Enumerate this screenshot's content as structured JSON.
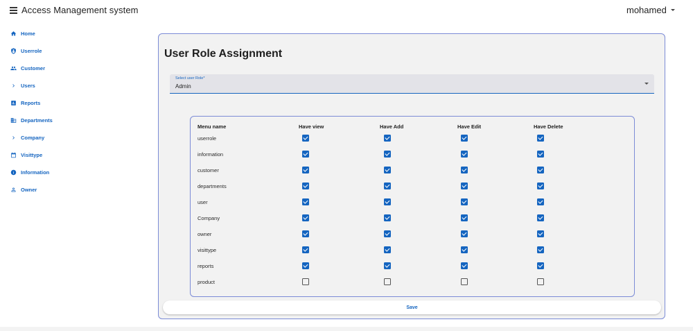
{
  "app": {
    "title": "Access Management system",
    "user_name": "mohamed"
  },
  "sidebar": {
    "items": [
      {
        "label": "Home",
        "icon": "home-icon"
      },
      {
        "label": "Userrole",
        "icon": "shield-user-icon"
      },
      {
        "label": "Customer",
        "icon": "people-icon"
      },
      {
        "label": "Users",
        "icon": "chevron-right-icon"
      },
      {
        "label": "Reports",
        "icon": "bar-chart-icon"
      },
      {
        "label": "Departments",
        "icon": "building-icon"
      },
      {
        "label": "Company",
        "icon": "chevron-right-icon"
      },
      {
        "label": "Visittype",
        "icon": "calendar-icon"
      },
      {
        "label": "Information",
        "icon": "info-icon"
      },
      {
        "label": "Owner",
        "icon": "person-outline-icon"
      }
    ]
  },
  "main": {
    "title": "User Role Assignment",
    "select": {
      "label": "Select user Role*",
      "value": "Admin"
    },
    "table": {
      "headers": [
        "Menu name",
        "Have view",
        "Have Add",
        "Have Edit",
        "Have Delete"
      ],
      "rows": [
        {
          "name": "userrole",
          "view": true,
          "add": true,
          "edit": true,
          "delete": true
        },
        {
          "name": "information",
          "view": true,
          "add": true,
          "edit": true,
          "delete": true
        },
        {
          "name": "customer",
          "view": true,
          "add": true,
          "edit": true,
          "delete": true
        },
        {
          "name": "departments",
          "view": true,
          "add": true,
          "edit": true,
          "delete": true
        },
        {
          "name": "user",
          "view": true,
          "add": true,
          "edit": true,
          "delete": true
        },
        {
          "name": "Company",
          "view": true,
          "add": true,
          "edit": true,
          "delete": true
        },
        {
          "name": "owner",
          "view": true,
          "add": true,
          "edit": true,
          "delete": true
        },
        {
          "name": "visittype",
          "view": true,
          "add": true,
          "edit": true,
          "delete": true
        },
        {
          "name": "reports",
          "view": true,
          "add": true,
          "edit": true,
          "delete": true
        },
        {
          "name": "product",
          "view": false,
          "add": false,
          "edit": false,
          "delete": false
        }
      ]
    },
    "save_label": "Save"
  },
  "colors": {
    "accent": "#1565c0",
    "panel_border": "#7b8bd6",
    "panel_bg": "#f2f2f2"
  }
}
